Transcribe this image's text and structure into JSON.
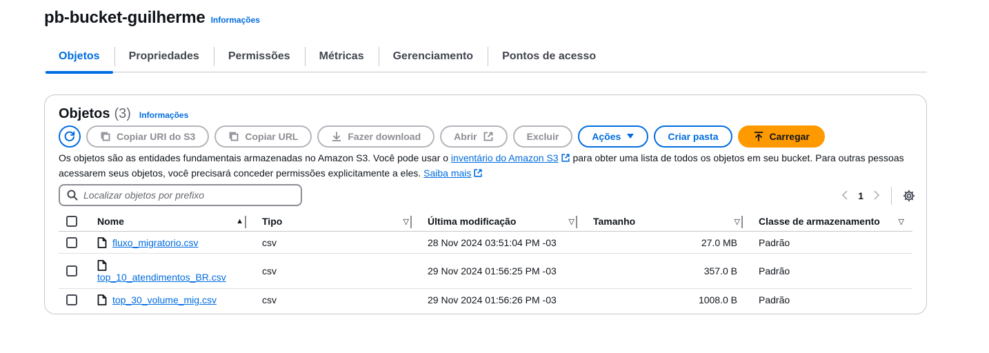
{
  "header": {
    "bucket_name": "pb-bucket-guilherme",
    "info_label": "Informações"
  },
  "tabs": [
    {
      "label": "Objetos",
      "active": true
    },
    {
      "label": "Propriedades"
    },
    {
      "label": "Permissões"
    },
    {
      "label": "Métricas"
    },
    {
      "label": "Gerenciamento"
    },
    {
      "label": "Pontos de acesso"
    }
  ],
  "objects_panel": {
    "title": "Objetos",
    "count": "(3)",
    "info_label": "Informações",
    "buttons": {
      "copy_uri": "Copiar URI do S3",
      "copy_url": "Copiar URL",
      "download": "Fazer download",
      "open": "Abrir",
      "delete": "Excluir",
      "actions": "Ações",
      "create_folder": "Criar pasta",
      "upload": "Carregar"
    },
    "description": {
      "part1": "Os objetos são as entidades fundamentais armazenadas no Amazon S3. Você pode usar o ",
      "link1": "inventário do Amazon S3",
      "part2": " para obter uma lista de todos os objetos em seu bucket. Para outras pessoas acessarem seus objetos, você precisará conceder permissões explicitamente a eles. ",
      "link2": "Saiba mais"
    },
    "search": {
      "placeholder": "Localizar objetos por prefixo"
    },
    "pagination": {
      "current_page": "1"
    },
    "table": {
      "columns": [
        "Nome",
        "Tipo",
        "Última modificação",
        "Tamanho",
        "Classe de armazenamento"
      ],
      "rows": [
        {
          "name": "fluxo_migratorio.csv",
          "type": "csv",
          "modified": "28 Nov 2024 03:51:04 PM -03",
          "size": "27.0 MB",
          "storage_class": "Padrão"
        },
        {
          "name": "top_10_atendimentos_BR.csv",
          "type": "csv",
          "modified": "29 Nov 2024 01:56:25 PM -03",
          "size": "357.0 B",
          "storage_class": "Padrão"
        },
        {
          "name": "top_30_volume_mig.csv",
          "type": "csv",
          "modified": "29 Nov 2024 01:56:26 PM -03",
          "size": "1008.0 B",
          "storage_class": "Padrão"
        }
      ]
    }
  },
  "colors": {
    "link_blue": "#006ce0",
    "upload_orange": "#ff9900",
    "disabled_gray": "#8c8c94",
    "border_gray": "#c6c6cd"
  }
}
